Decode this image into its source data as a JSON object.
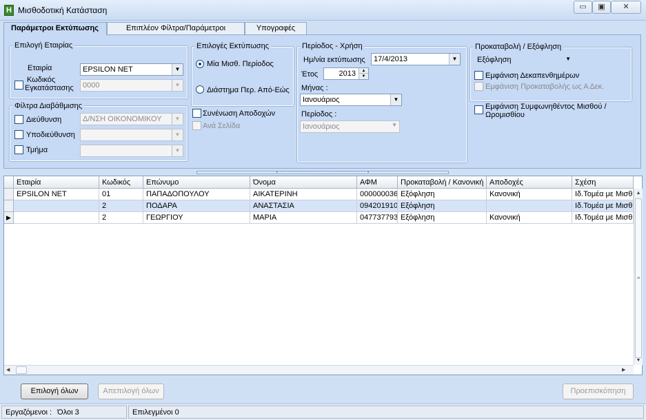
{
  "window": {
    "title": "Μισθοδοτική Κατάσταση",
    "app_icon_letter": "H",
    "minimize_glyph": "▭",
    "restore_glyph": "▣",
    "close_glyph": "✕"
  },
  "tabs": [
    {
      "label": "Παράμετροι Εκτύπωσης",
      "active": true
    },
    {
      "label": "Επιπλέον Φίλτρα/Παράμετροι",
      "active": false
    },
    {
      "label": "Υπογραφές",
      "active": false
    }
  ],
  "company_group": {
    "title": "Επιλογή Εταιρίας",
    "company_label": "Εταιρία",
    "company_value": "EPSILON NET",
    "install_code_label_line1": "Κωδικός",
    "install_code_label_line2": "Εγκατάστασης",
    "install_code_value": "0000"
  },
  "filters_group": {
    "title": "Φίλτρα Διαβάθμισης",
    "direction_label": "Διεύθυνση",
    "direction_value": "Δ/ΝΣΗ ΟΙΚΟΝΟΜΙΚΟΥ",
    "subdirection_label": "Υποδιεύθυνση",
    "subdirection_value": "",
    "department_label": "Τμήμα",
    "department_value": ""
  },
  "print_options": {
    "title": "Επιλογές Εκτύπωσης",
    "radio_single": "Μία Μισθ. Περίοδος",
    "radio_range": "Διάστημα Περ. Από-Εώς",
    "merge_label": "Συνένωση Αποδοχών",
    "per_page_label": "Ανά Σελίδα"
  },
  "period_group": {
    "title": "Περίοδος - Χρήση",
    "print_date_label": "Ημ/νία εκτύπωσης",
    "print_date_value": "17/4/2013",
    "year_label": "Έτος",
    "year_value": "2013",
    "month_label": "Μήνας :",
    "month_value": "Ιανουάριος",
    "period_label": "Περίοδος :",
    "period_value": "Ιανουάριος"
  },
  "advance_group": {
    "title": "Προκαταβολή / Εξόφληση",
    "type_value": "Εξόφληση",
    "show_fortnights_label": "Εμφάνιση Δεκαπενθημέρων",
    "show_advance_label": "Εμφάνιση Προκαταβολής ως Α Δεκ.",
    "show_agreed_line1": "Εμφάνιση Συμφωνηθέντος Μισθού /",
    "show_agreed_line2": "Ωρομισθίου"
  },
  "grid": {
    "columns": [
      "Εταιρία",
      "Κωδικός",
      "Επώνυμο",
      "Όνομα",
      "ΑΦΜ",
      "Προκαταβολή / Κανονική",
      "Αποδοχές",
      "Σχέση"
    ],
    "rows": [
      [
        "EPSILON NET",
        "01",
        "ΠΑΠΑΔΟΠΟΥΛΟΥ",
        "ΑΙΚΑΤΕΡΙΝΗ",
        "000000036",
        "Εξόφληση",
        "Κανονική",
        "Ιδ.Τομέα με Μισθ"
      ],
      [
        "",
        "2",
        "ΠΟΔΑΡΑ",
        "ΑΝΑΣΤΑΣΙΑ",
        "094201910",
        "Εξόφληση",
        "",
        "Ιδ.Τομέα με Μισθ"
      ],
      [
        "",
        "2",
        "ΓΕΩΡΓΙΟΥ",
        "ΜΑΡΙΑ",
        "047737793",
        "Εξόφληση",
        "Κανονική",
        "Ιδ.Τομέα με Μισθ"
      ]
    ],
    "current_row_marker": "▶"
  },
  "buttons": {
    "select_all": "Επιλογή όλων",
    "deselect_all": "Απεπιλογή όλων",
    "preview": "Προεπισκόπηση"
  },
  "status": {
    "employees_label": "Εργαζόμενοι :",
    "total_text": "Όλοι 3",
    "selected_text": "Επιλεγμένοι 0"
  }
}
